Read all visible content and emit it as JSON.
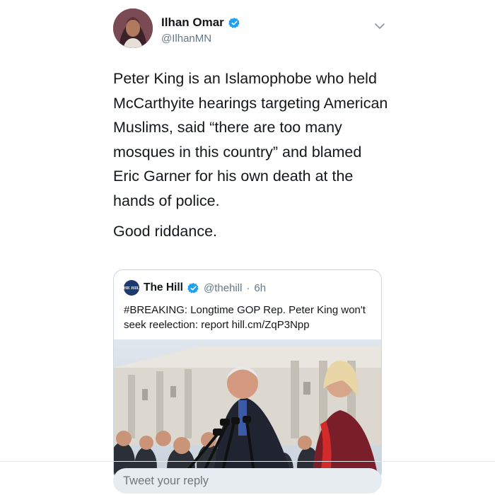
{
  "author": {
    "display_name": "Ilhan Omar",
    "handle": "@IlhanMN",
    "avatar_icon": "profile-photo",
    "verified_color": "#1da1f2"
  },
  "tweet": {
    "paragraphs": [
      "Peter King is an Islamophobe who held McCarthyite hearings targeting American Muslims, said “there are too many mosques in this country” and blamed Eric Garner for his own death at the hands of police.",
      "Good riddance."
    ]
  },
  "quoted_tweet": {
    "name": "The Hill",
    "handle": "@thehill",
    "separator": "·",
    "time": "6h",
    "logo_text": "THE HILL",
    "text": "#BREAKING: Longtime GOP Rep. Peter King won't seek reelection: report hill.cm/ZqP3Npp",
    "image_icon": "press-conference-photo"
  },
  "reply": {
    "placeholder": "Tweet your reply"
  }
}
